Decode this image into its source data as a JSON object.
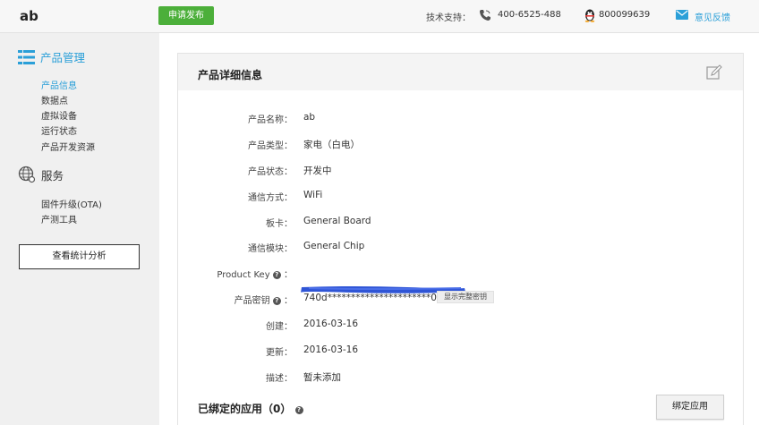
{
  "header": {
    "brand": "ab",
    "publish_label": "申请发布",
    "support_label": "技术支持：",
    "phone": "400-6525-488",
    "qq": "800099639",
    "feedback_label": "意见反馈",
    "icons": [
      "phone-icon",
      "qq-penguin-icon",
      "mail-icon"
    ]
  },
  "sidebar": {
    "products_title": "产品管理",
    "products_items": [
      {
        "label": "产品信息",
        "active": true
      },
      {
        "label": "数据点"
      },
      {
        "label": "虚拟设备"
      },
      {
        "label": "运行状态"
      },
      {
        "label": "产品开发资源"
      }
    ],
    "service_title": "服务",
    "service_items": [
      {
        "label": "固件升级(OTA)"
      },
      {
        "label": "产测工具"
      }
    ],
    "stats_button": "查看统计分析"
  },
  "detail": {
    "title": "产品详细信息",
    "rows": [
      {
        "label": "产品名称：",
        "value": "ab"
      },
      {
        "label": "产品类型：",
        "value": "家电（白电）"
      },
      {
        "label": "产品状态：",
        "value": "开发中"
      },
      {
        "label": "通信方式：",
        "value": "WiFi"
      },
      {
        "label": "板卡：",
        "value": "General Board"
      },
      {
        "label": "通信模块：",
        "value": "General Chip"
      },
      {
        "label": "Product Key",
        "value": ""
      },
      {
        "label": "产品密钥",
        "value": "740d**********************0cf4"
      },
      {
        "label": "创建：",
        "value": "2016-03-16"
      },
      {
        "label": "更新：",
        "value": "2016-03-16"
      },
      {
        "label": "描述：",
        "value": "暂未添加"
      }
    ],
    "help_glyph": "?",
    "colon": "：",
    "show_key_button": "显示完整密钥"
  },
  "bound_apps": {
    "title": "已绑定的应用（0）",
    "bind_button": "绑定应用"
  },
  "colors": {
    "accent": "#2a9fd8",
    "publish": "#4caf3a",
    "redaction": "#2f55d6"
  }
}
